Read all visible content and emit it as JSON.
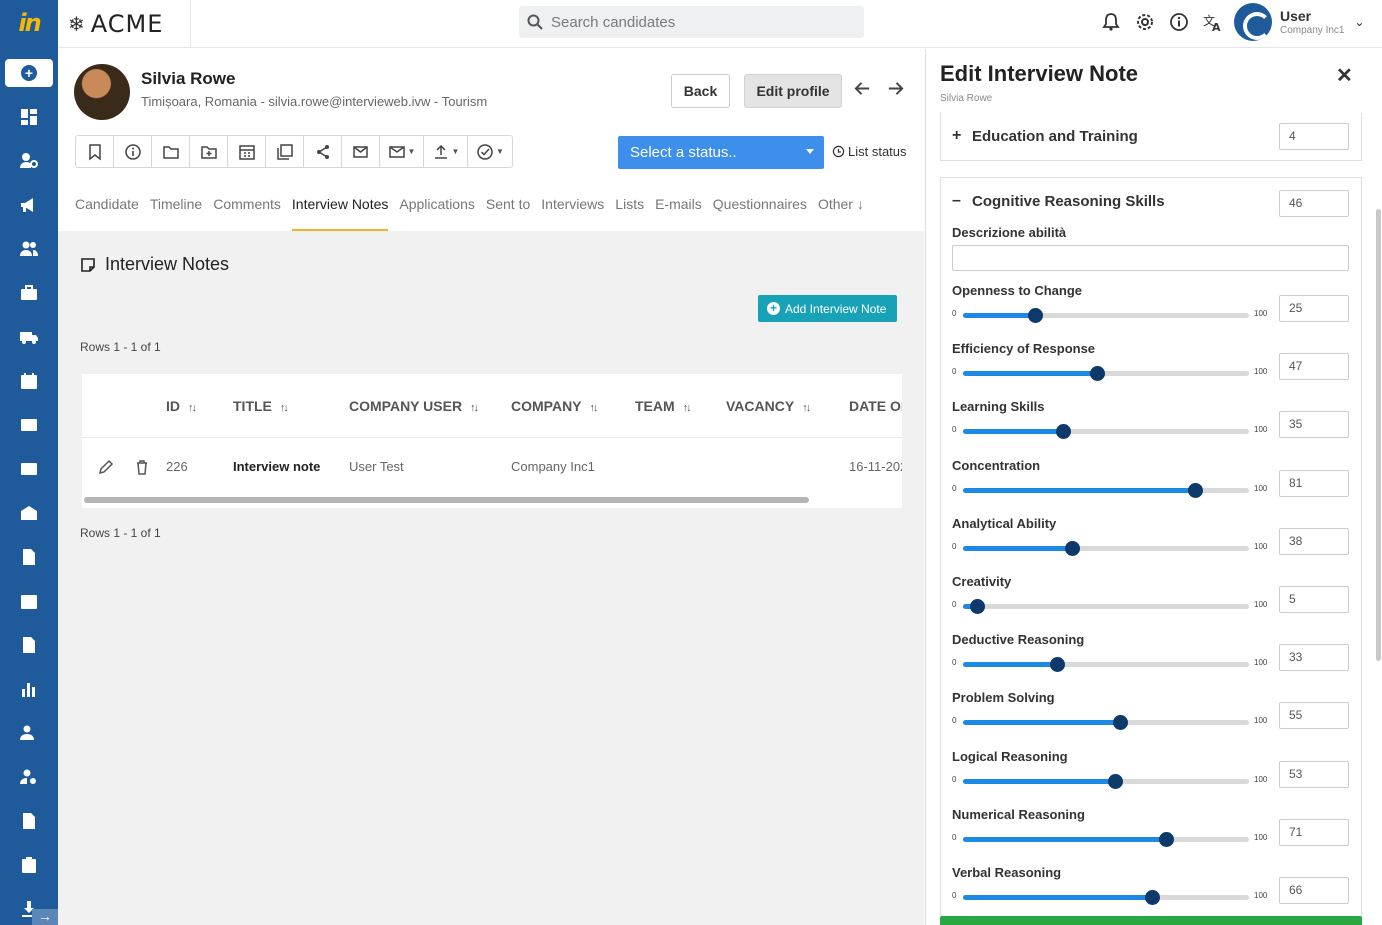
{
  "app": {
    "logo_text": "in",
    "brand": "ACME"
  },
  "search": {
    "placeholder": "Search candidates"
  },
  "user": {
    "name": "User",
    "company": "Company Inc1"
  },
  "candidate": {
    "name": "Silvia Rowe",
    "subtitle": "Timișoara, Romania - silvia.rowe@intervieweb.ivw - Tourism"
  },
  "buttons": {
    "back": "Back",
    "edit_profile": "Edit profile",
    "add_note": "Add Interview Note"
  },
  "status": {
    "select_label": "Select a status..",
    "list_status": "List status"
  },
  "tabs": [
    {
      "label": "Candidate"
    },
    {
      "label": "Timeline"
    },
    {
      "label": "Comments"
    },
    {
      "label": "Interview Notes",
      "active": true
    },
    {
      "label": "Applications"
    },
    {
      "label": "Sent to"
    },
    {
      "label": "Interviews"
    },
    {
      "label": "Lists"
    },
    {
      "label": "E-mails"
    },
    {
      "label": "Questionnaires"
    },
    {
      "label": "Other ↓"
    }
  ],
  "section": {
    "title": "Interview Notes",
    "rows_info": "Rows 1 - 1 of 1"
  },
  "table": {
    "columns": [
      "ID",
      "TITLE",
      "COMPANY USER",
      "COMPANY",
      "TEAM",
      "VACANCY",
      "DATE OF"
    ],
    "rows": [
      {
        "id": "226",
        "title": "Interview note",
        "company_user": "User Test",
        "company": "Company Inc1",
        "team": "",
        "vacancy": "",
        "date": "16-11-202"
      }
    ]
  },
  "panel": {
    "title": "Edit Interview Note",
    "subtitle": "Silvia Rowe",
    "education": {
      "sign": "+",
      "label": "Education and Training",
      "score": "4"
    },
    "cognitive": {
      "sign": "–",
      "label": "Cognitive Reasoning Skills",
      "score": "46"
    },
    "description_label": "Descrizione abilità",
    "slider_min": "0",
    "slider_max": "100",
    "skills": [
      {
        "label": "Openness to Change",
        "value": 25
      },
      {
        "label": "Efficiency of Response",
        "value": 47
      },
      {
        "label": "Learning Skills",
        "value": 35
      },
      {
        "label": "Concentration",
        "value": 81
      },
      {
        "label": "Analytical Ability",
        "value": 38
      },
      {
        "label": "Creativity",
        "value": 5
      },
      {
        "label": "Deductive Reasoning",
        "value": 33
      },
      {
        "label": "Problem Solving",
        "value": 55
      },
      {
        "label": "Logical Reasoning",
        "value": 53
      },
      {
        "label": "Numerical Reasoning",
        "value": 71
      },
      {
        "label": "Verbal Reasoning",
        "value": 66
      }
    ]
  },
  "colors": {
    "rail": "#1f5a9a",
    "accent": "#3e8eec",
    "teal": "#17a2b8",
    "slider_fill": "#1e88e5",
    "save": "#28a745",
    "tab_underline": "#f0b429"
  }
}
